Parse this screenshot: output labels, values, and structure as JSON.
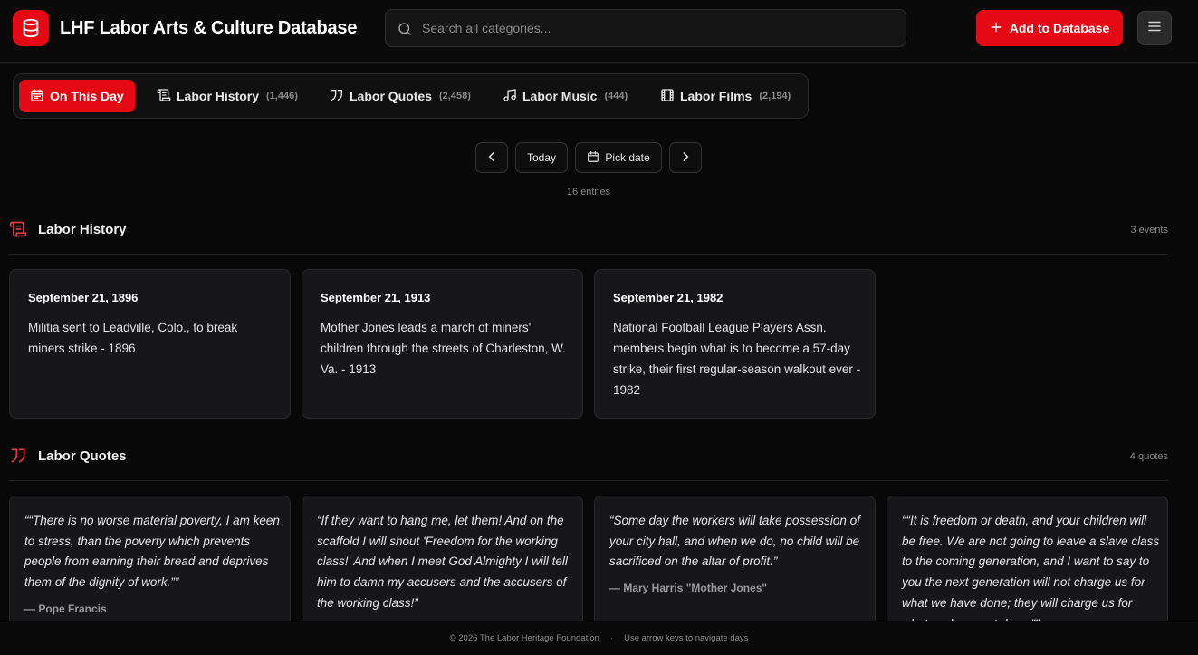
{
  "header": {
    "title": "LHF Labor Arts & Culture Database",
    "search_placeholder": "Search all categories...",
    "add_label": "Add to Database"
  },
  "tabs": [
    {
      "label": "On This Day",
      "count": "",
      "icon": "calendar-icon",
      "active": true
    },
    {
      "label": "Labor History",
      "count": "(1,446)",
      "icon": "scroll-icon",
      "active": false
    },
    {
      "label": "Labor Quotes",
      "count": "(2,458)",
      "icon": "quote-icon",
      "active": false
    },
    {
      "label": "Labor Music",
      "count": "(444)",
      "icon": "music-note-icon",
      "active": false
    },
    {
      "label": "Labor Films",
      "count": "(2,194)",
      "icon": "film-icon",
      "active": false
    }
  ],
  "date_nav": {
    "today_label": "Today",
    "pick_label": "Pick date",
    "entries_text": "16 entries"
  },
  "sections": {
    "history": {
      "title": "Labor History",
      "count": "3 events",
      "items": [
        {
          "date": "September 21, 1896",
          "text": "Militia sent to Leadville, Colo., to break miners strike - 1896"
        },
        {
          "date": "September 21, 1913",
          "text": "Mother Jones leads a march of miners' children through the streets of Charleston, W. Va. - 1913"
        },
        {
          "date": "September 21, 1982",
          "text": "National Football League Players Assn. members begin what is to become a 57-day strike, their first regular-season walkout ever - 1982"
        }
      ]
    },
    "quotes": {
      "title": "Labor Quotes",
      "count": "4 quotes",
      "items": [
        {
          "text": "““There is no worse material poverty, I am keen to stress, than the poverty which prevents people from earning their bread and deprives them of the dignity of work.””",
          "author": "— Pope Francis"
        },
        {
          "text": "“If they want to hang me, let them! And on the scaffold I will shout 'Freedom for the working class!' And when I meet God Almighty I will tell him to damn my accusers and the accusers of the working class!”",
          "author": ""
        },
        {
          "text": "“Some day the workers will take possession of your city hall, and when we do, no child will be sacrificed on the altar of profit.”",
          "author": "— Mary Harris \"Mother Jones\""
        },
        {
          "text": "““It is freedom or death, and your children will be free. We are not going to leave a slave class to the coming generation, and I want to say to you the next generation will not charge us for what we have done; they will charge us for what we have not done.””",
          "author": ""
        }
      ]
    }
  },
  "footer": {
    "copyright": "© 2026 The Labor Heritage Foundation",
    "separator": "·",
    "hint": "Use arrow keys to navigate days"
  },
  "colors": {
    "accent": "#e50914",
    "background": "#080808",
    "card": "#17171a"
  }
}
